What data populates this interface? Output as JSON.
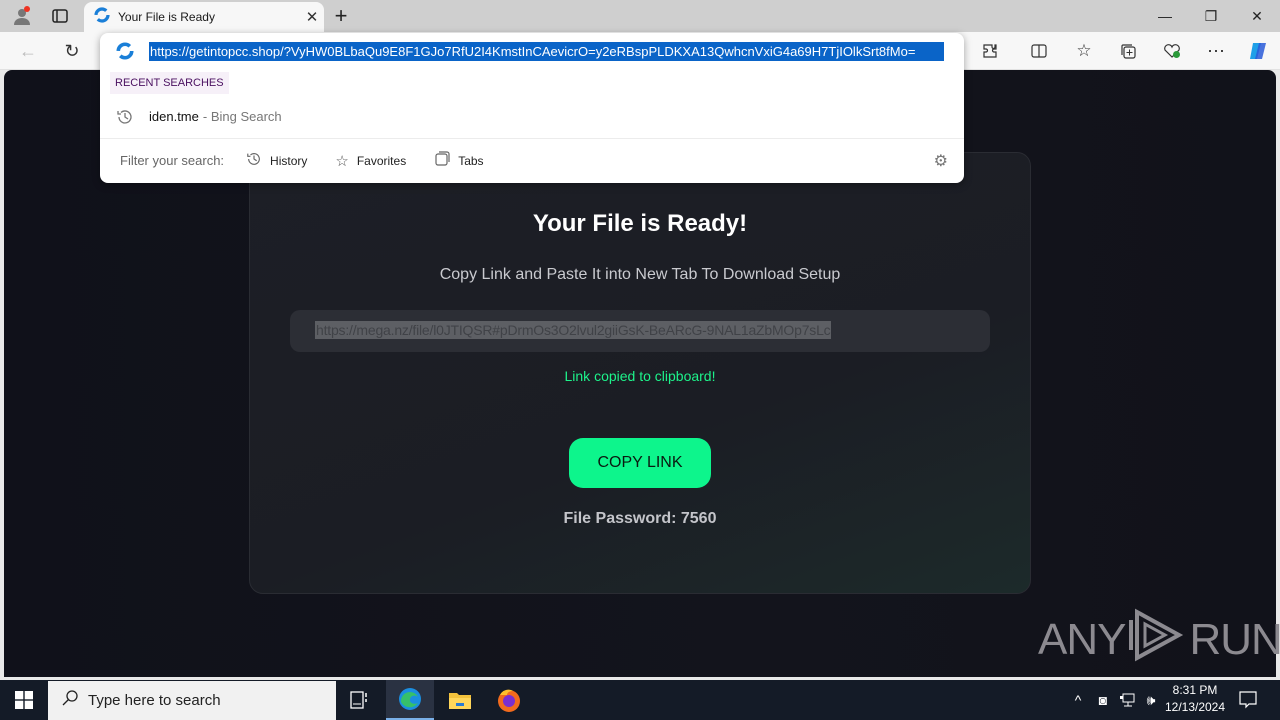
{
  "browser": {
    "tab": {
      "title": "Your File is Ready",
      "close_icon": "close-icon"
    },
    "new_tab_icon": "plus-icon",
    "window_controls": {
      "minimize": "—",
      "restore": "❐",
      "close": "✕"
    },
    "address_bar": {
      "url": "https://getintopcc.shop/?VyHW0BLbaQu9E8F1GJo7RfU2I4KmstInCAevicrO=y2eRBspPLDKXA13QwhcnVxiG4a69H7TjIOlkSrt8fMo=",
      "selected": true
    },
    "dropdown": {
      "recent_label": "RECENT SEARCHES",
      "recent_items": [
        {
          "query": "iden.tme",
          "source": "- Bing Search"
        }
      ],
      "filter_label": "Filter your search:",
      "filters": [
        {
          "label": "History",
          "icon": "history-icon"
        },
        {
          "label": "Favorites",
          "icon": "star-icon"
        },
        {
          "label": "Tabs",
          "icon": "tabs-icon"
        }
      ]
    }
  },
  "page": {
    "title": "Your File is Ready!",
    "subtitle": "Copy Link and Paste It into New Tab To Download Setup",
    "link": "https://mega.nz/file/l0JTIQSR#pDrmOs3O2lvul2giiGsK-BeARcG-9NAL1aZbMOp7sLc",
    "copied_message": "Link copied to clipboard!",
    "copy_button": "COPY LINK",
    "password_label": "File Password: 7560",
    "accent_color": "#0df58c"
  },
  "watermark": {
    "left": "ANY",
    "right": "RUN"
  },
  "taskbar": {
    "search_placeholder": "Type here to search",
    "time": "8:31 PM",
    "date": "12/13/2024"
  }
}
